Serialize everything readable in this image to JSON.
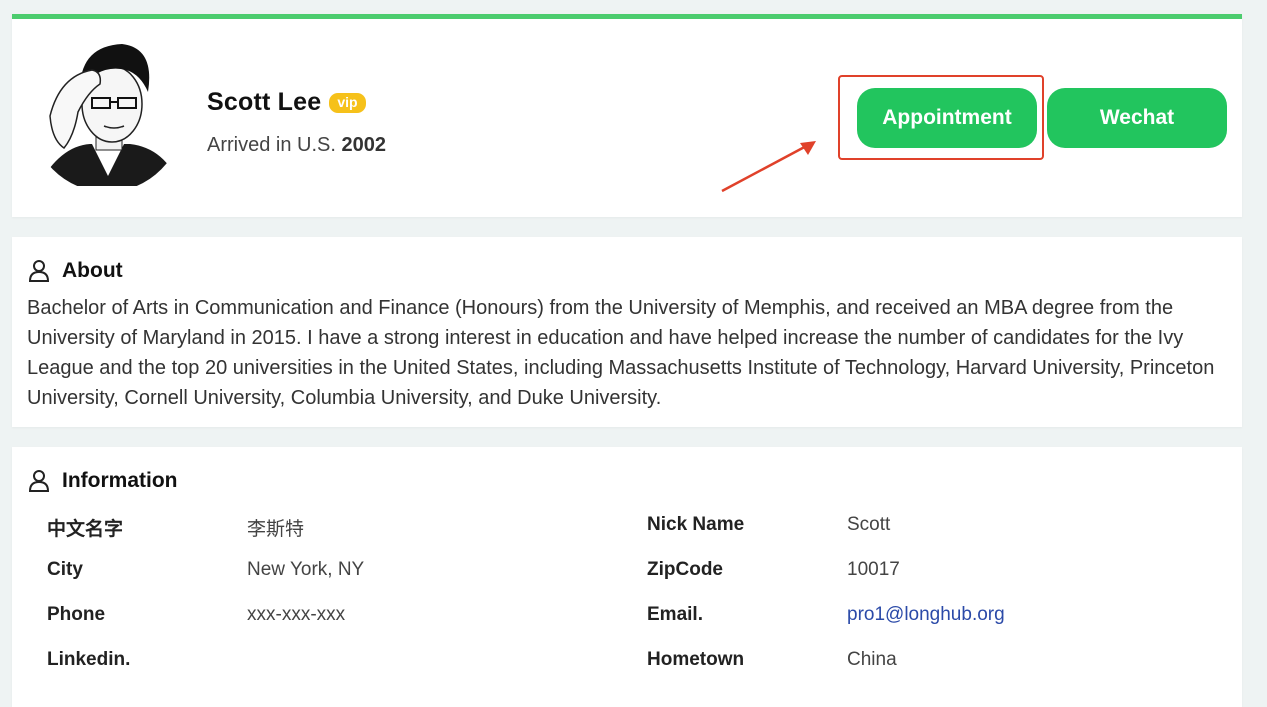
{
  "profile": {
    "name": "Scott Lee",
    "badge": "vip",
    "arrived_prefix": "Arrived in U.S.",
    "arrived_year": "2002",
    "buttons": {
      "appointment": "Appointment",
      "wechat": "Wechat"
    },
    "accent_color": "#22c55e",
    "highlight_color": "#e0412a"
  },
  "about": {
    "heading": "About",
    "icon": "user-icon",
    "text": "Bachelor of Arts in Communication and Finance (Honours) from the University of Memphis, and received an MBA degree from the University of Maryland in 2015. I have a strong interest in education and have helped increase the number of candidates for the Ivy League and the top 20 universities in the United States, including Massachusetts Institute of Technology, Harvard University, Princeton University, Cornell University, Columbia University, and Duke University."
  },
  "information": {
    "heading": "Information",
    "icon": "user-icon",
    "rows": [
      {
        "left_label": "中文名字",
        "left_value": "李斯特",
        "right_label": "Nick Name",
        "right_value": "Scott"
      },
      {
        "left_label": "City",
        "left_value": "New York, NY",
        "right_label": "ZipCode",
        "right_value": "10017"
      },
      {
        "left_label": "Phone",
        "left_value": "xxx-xxx-xxx",
        "right_label": "Email.",
        "right_value": "pro1@longhub.org"
      },
      {
        "left_label": "Linkedin.",
        "left_value": "",
        "right_label": "Hometown",
        "right_value": "China"
      }
    ]
  }
}
